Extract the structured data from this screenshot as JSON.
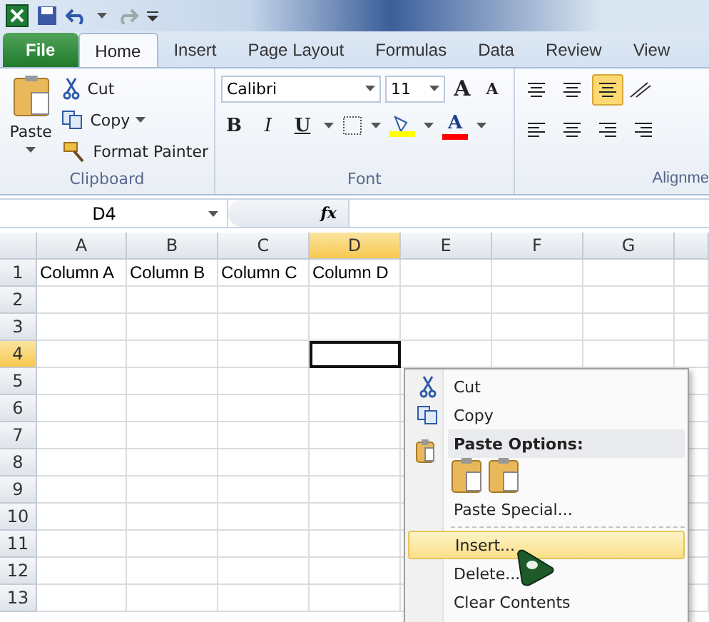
{
  "tabs": [
    {
      "label": "File",
      "kind": "file",
      "selected": false
    },
    {
      "label": "Home",
      "kind": "tab",
      "selected": true
    },
    {
      "label": "Insert",
      "kind": "tab",
      "selected": false
    },
    {
      "label": "Page Layout",
      "kind": "tab",
      "selected": false
    },
    {
      "label": "Formulas",
      "kind": "tab",
      "selected": false
    },
    {
      "label": "Data",
      "kind": "tab",
      "selected": false
    },
    {
      "label": "Review",
      "kind": "tab",
      "selected": false
    },
    {
      "label": "View",
      "kind": "tab",
      "selected": false
    }
  ],
  "ribbon": {
    "clipboard": {
      "label": "Clipboard",
      "paste": "Paste",
      "cut": "Cut",
      "copy": "Copy",
      "format_painter": "Format Painter"
    },
    "font": {
      "label": "Font",
      "name": "Calibri",
      "size": "11",
      "grow": "A",
      "shrink": "A",
      "bold": "B",
      "italic": "I",
      "underline": "U",
      "font_color": "A"
    },
    "alignment": {
      "label": "Alignme"
    }
  },
  "formula_bar": {
    "name_box": "D4",
    "fx": "fx"
  },
  "sheet": {
    "columns": [
      {
        "label": "A",
        "selected": false
      },
      {
        "label": "B",
        "selected": false
      },
      {
        "label": "C",
        "selected": false
      },
      {
        "label": "D",
        "selected": true
      },
      {
        "label": "E",
        "selected": false
      },
      {
        "label": "F",
        "selected": false
      },
      {
        "label": "G",
        "selected": false
      }
    ],
    "rows": [
      {
        "label": "1",
        "selected": false,
        "cells": [
          "Column A",
          "Column B",
          "Column C",
          "Column D"
        ]
      },
      {
        "label": "2",
        "selected": false
      },
      {
        "label": "3",
        "selected": false
      },
      {
        "label": "4",
        "selected": true
      },
      {
        "label": "5",
        "selected": false
      },
      {
        "label": "6",
        "selected": false
      },
      {
        "label": "7",
        "selected": false
      },
      {
        "label": "8",
        "selected": false
      },
      {
        "label": "9",
        "selected": false
      },
      {
        "label": "10",
        "selected": false
      },
      {
        "label": "11",
        "selected": false
      },
      {
        "label": "12",
        "selected": false
      },
      {
        "label": "13",
        "selected": false
      }
    ]
  },
  "context_menu": [
    {
      "kind": "cut",
      "label": "Cut",
      "selected": false
    },
    {
      "kind": "copy",
      "label": "Copy",
      "selected": false
    },
    {
      "kind": "paste_header",
      "label": "Paste Options:"
    },
    {
      "kind": "paste_options"
    },
    {
      "kind": "plain",
      "label": "Paste Special...",
      "selected": false
    },
    {
      "kind": "separator"
    },
    {
      "kind": "plain",
      "label": "Insert...",
      "selected": true
    },
    {
      "kind": "plain",
      "label": "Delete...",
      "selected": false
    },
    {
      "kind": "plain",
      "label": "Clear Contents",
      "selected": false
    }
  ]
}
